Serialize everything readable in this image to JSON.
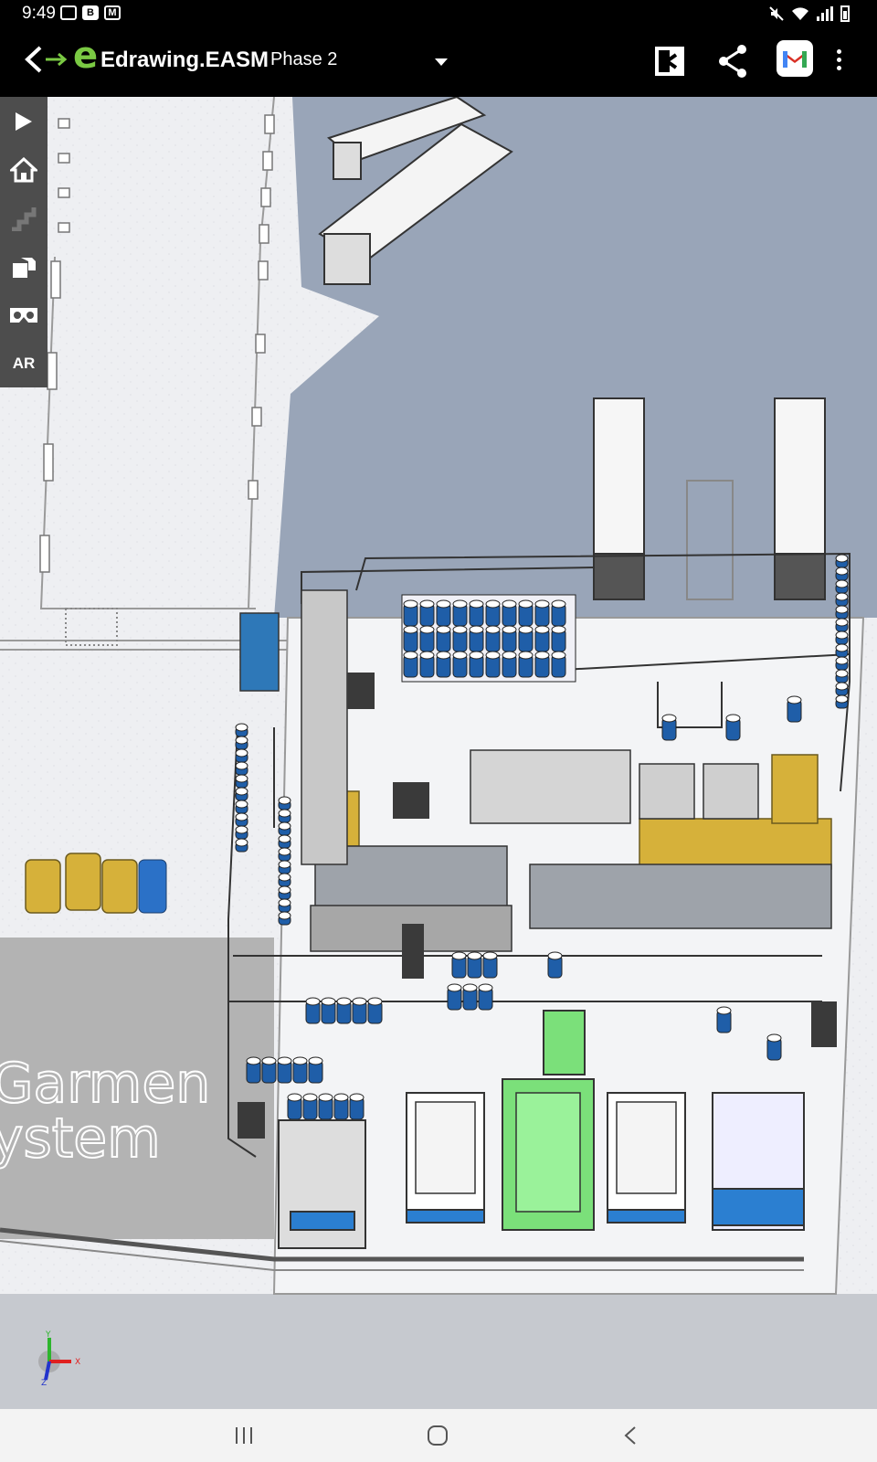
{
  "status_bar": {
    "time": "9:49",
    "left_icons": [
      "image-icon",
      "b-app-icon",
      "gmail-notification-icon"
    ],
    "right_icons": [
      "mute-icon",
      "wifi-icon",
      "signal-icon",
      "battery-icon"
    ]
  },
  "app_bar": {
    "app_name": "Edrawing.EASM",
    "configuration": "Phase 2",
    "actions": [
      "exit-fullscreen-icon",
      "share-icon",
      "gmail-icon",
      "more-options-icon"
    ]
  },
  "side_toolbar": {
    "buttons": [
      "play-icon",
      "home-icon",
      "steps-icon",
      "explode-icon",
      "vr-headset-icon",
      "AR"
    ]
  },
  "model": {
    "watermark_line1": "Garmen",
    "watermark_line2": "ystem"
  },
  "axis_triad": {
    "x_label": "X",
    "y_label": "Y",
    "z_label": "Z"
  },
  "nav_bar": [
    "recent-apps-icon",
    "home-circle-icon",
    "back-chevron-icon"
  ],
  "colors": {
    "background": "#000000",
    "viewport": "#eeeff2",
    "water_blue_gray": "#99a5b8",
    "machine_blue": "#1f5ea8",
    "machine_yellow": "#d6b13a",
    "machine_green": "#7be07a",
    "floor_gray": "#b3b3b3",
    "toolbar_gray": "#4d4d4d",
    "accent_green": "#7ac943"
  }
}
